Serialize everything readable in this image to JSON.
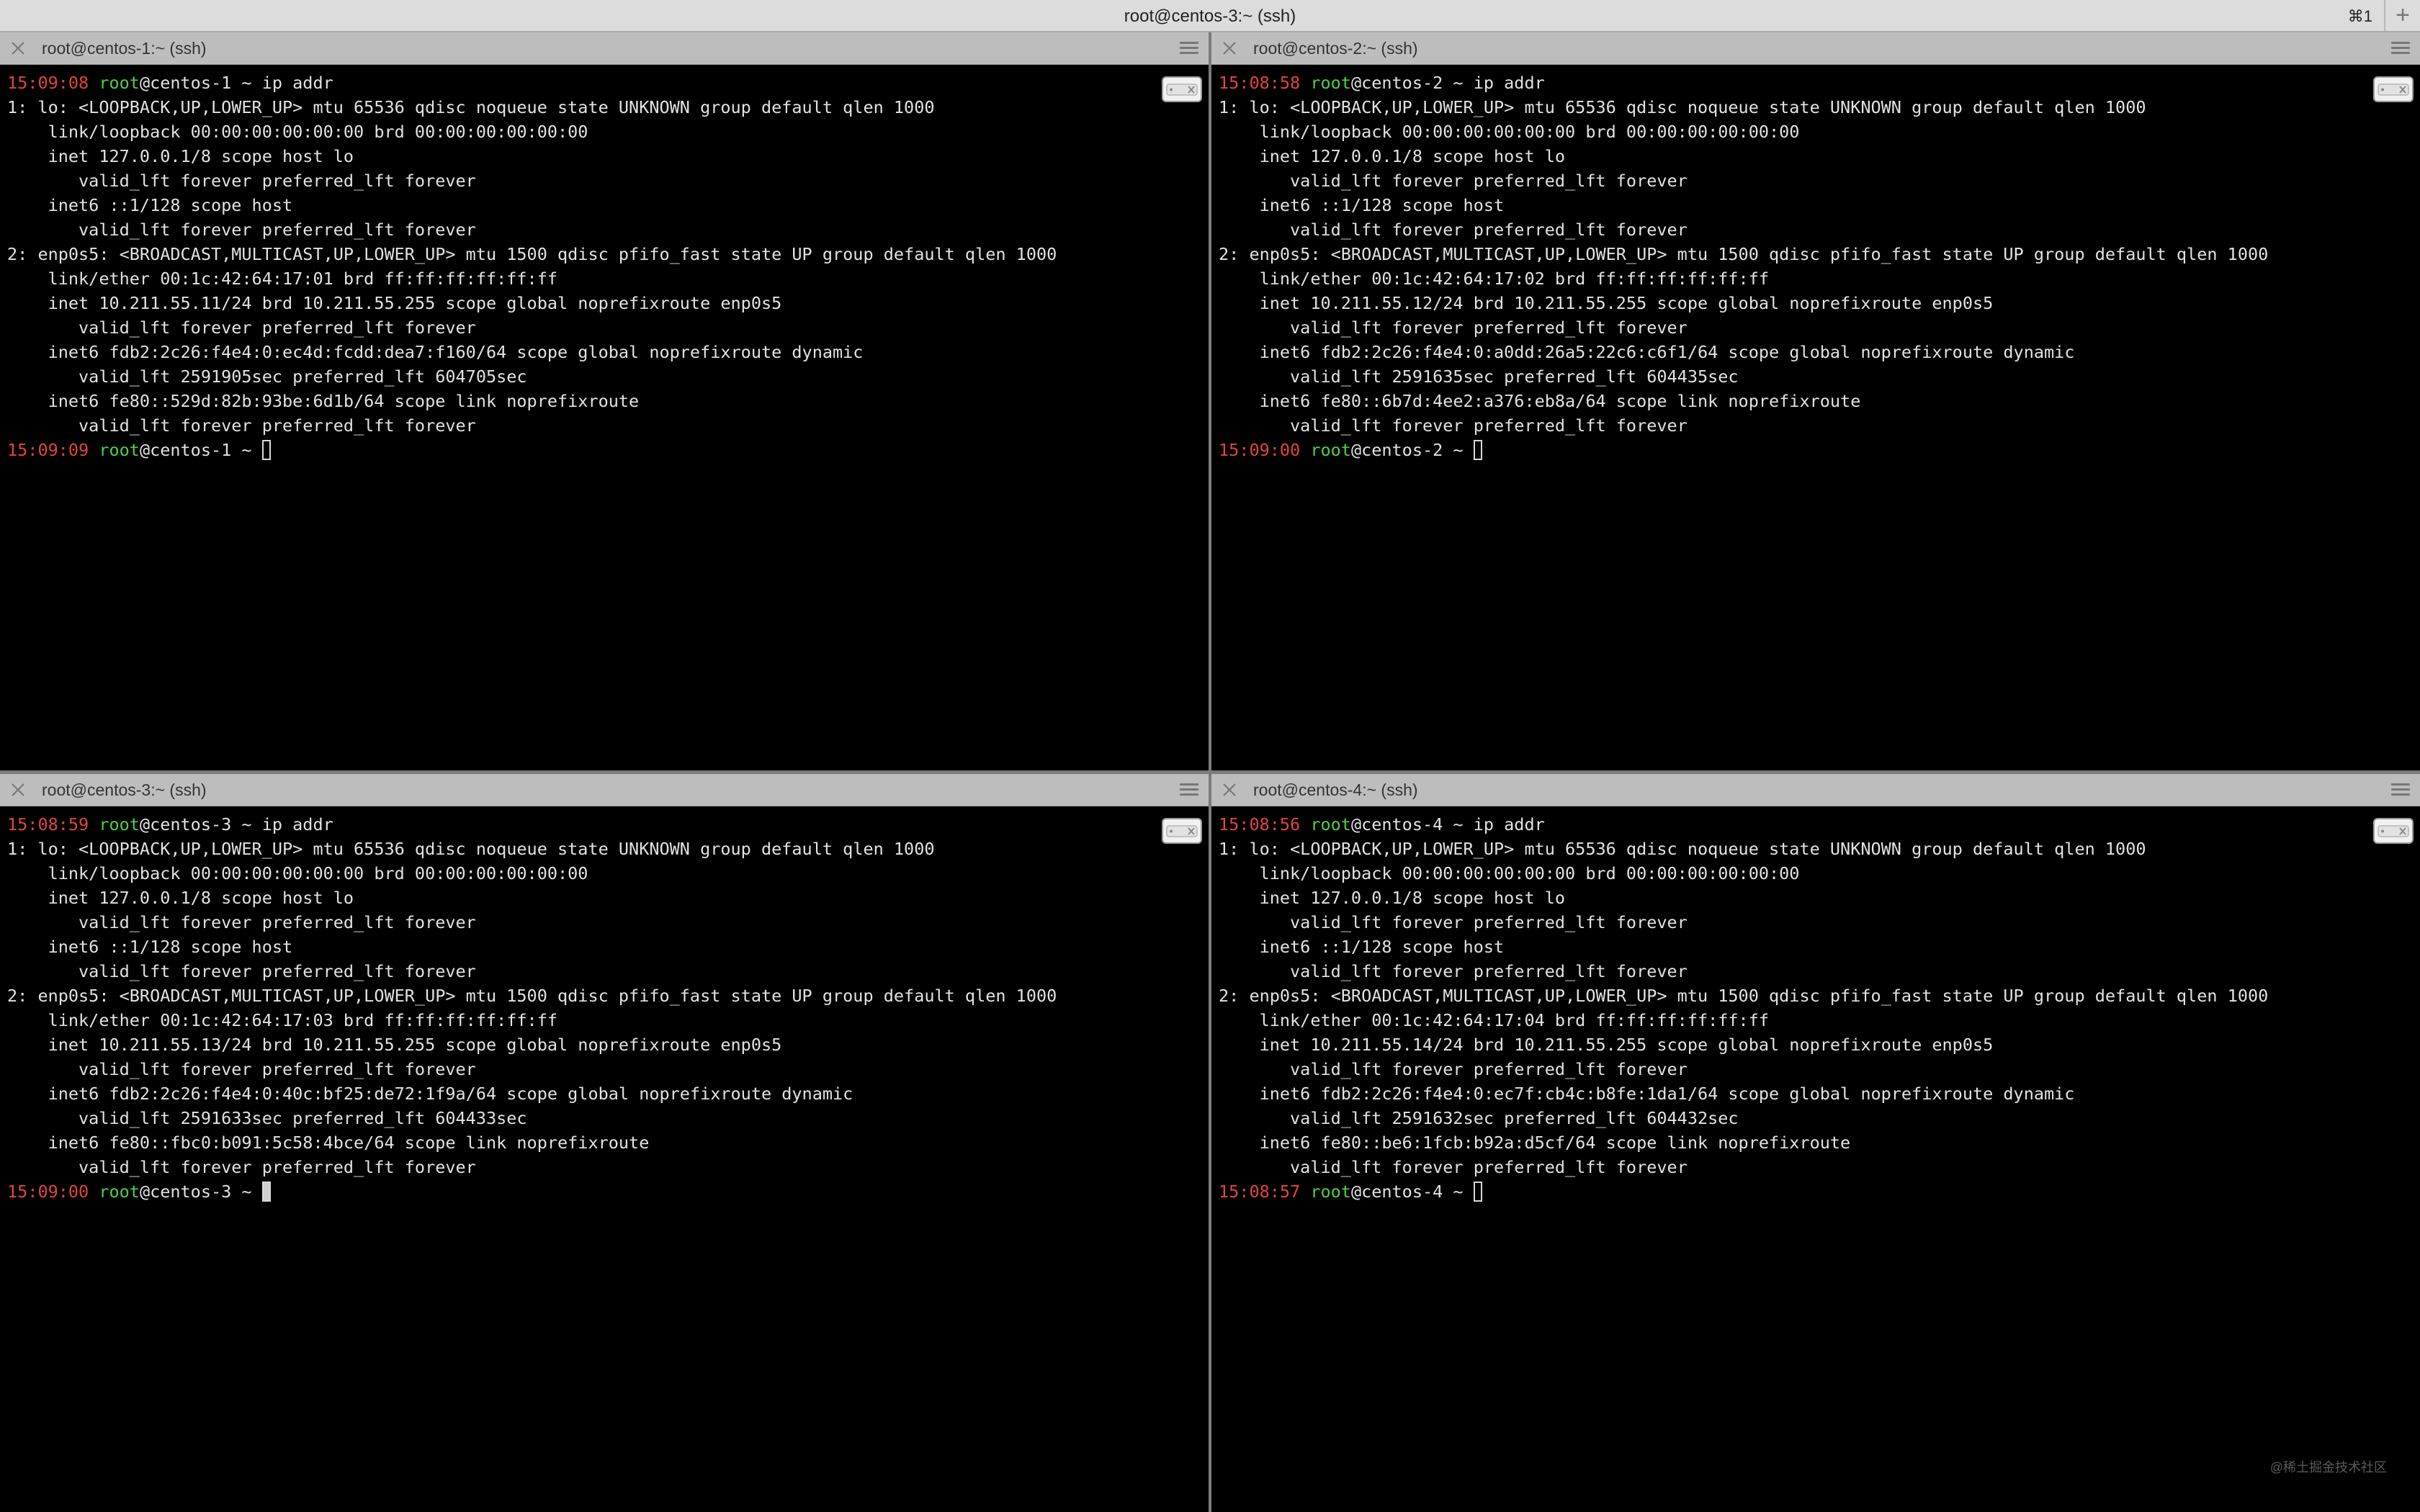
{
  "window": {
    "title": "root@centos-3:~ (ssh)",
    "shortcut": "⌘1",
    "new_tab": "+"
  },
  "colors": {
    "timestamp": "#e0463f",
    "user": "#4fcf4a",
    "text": "#e2e2e2",
    "background": "#000000"
  },
  "watermark": "@稀土掘金技术社区",
  "panes": [
    {
      "title": "root@centos-1:~ (ssh)",
      "cursor": "hollow",
      "prompt1": {
        "time": "15:09:08",
        "user": "root",
        "rest": "@centos-1 ~ ip addr"
      },
      "output": [
        "1: lo: <LOOPBACK,UP,LOWER_UP> mtu 65536 qdisc noqueue state UNKNOWN group default qlen 1000",
        "    link/loopback 00:00:00:00:00:00 brd 00:00:00:00:00:00",
        "    inet 127.0.0.1/8 scope host lo",
        "       valid_lft forever preferred_lft forever",
        "    inet6 ::1/128 scope host",
        "       valid_lft forever preferred_lft forever",
        "2: enp0s5: <BROADCAST,MULTICAST,UP,LOWER_UP> mtu 1500 qdisc pfifo_fast state UP group default qlen 1000",
        "    link/ether 00:1c:42:64:17:01 brd ff:ff:ff:ff:ff:ff",
        "    inet 10.211.55.11/24 brd 10.211.55.255 scope global noprefixroute enp0s5",
        "       valid_lft forever preferred_lft forever",
        "    inet6 fdb2:2c26:f4e4:0:ec4d:fcdd:dea7:f160/64 scope global noprefixroute dynamic",
        "       valid_lft 2591905sec preferred_lft 604705sec",
        "    inet6 fe80::529d:82b:93be:6d1b/64 scope link noprefixroute",
        "       valid_lft forever preferred_lft forever"
      ],
      "prompt2": {
        "time": "15:09:09",
        "user": "root",
        "rest": "@centos-1 ~ "
      }
    },
    {
      "title": "root@centos-2:~ (ssh)",
      "cursor": "hollow",
      "prompt1": {
        "time": "15:08:58",
        "user": "root",
        "rest": "@centos-2 ~ ip addr"
      },
      "output": [
        "1: lo: <LOOPBACK,UP,LOWER_UP> mtu 65536 qdisc noqueue state UNKNOWN group default qlen 1000",
        "    link/loopback 00:00:00:00:00:00 brd 00:00:00:00:00:00",
        "    inet 127.0.0.1/8 scope host lo",
        "       valid_lft forever preferred_lft forever",
        "    inet6 ::1/128 scope host",
        "       valid_lft forever preferred_lft forever",
        "2: enp0s5: <BROADCAST,MULTICAST,UP,LOWER_UP> mtu 1500 qdisc pfifo_fast state UP group default qlen 1000",
        "    link/ether 00:1c:42:64:17:02 brd ff:ff:ff:ff:ff:ff",
        "    inet 10.211.55.12/24 brd 10.211.55.255 scope global noprefixroute enp0s5",
        "       valid_lft forever preferred_lft forever",
        "    inet6 fdb2:2c26:f4e4:0:a0dd:26a5:22c6:c6f1/64 scope global noprefixroute dynamic",
        "       valid_lft 2591635sec preferred_lft 604435sec",
        "    inet6 fe80::6b7d:4ee2:a376:eb8a/64 scope link noprefixroute",
        "       valid_lft forever preferred_lft forever"
      ],
      "prompt2": {
        "time": "15:09:00",
        "user": "root",
        "rest": "@centos-2 ~ "
      }
    },
    {
      "title": "root@centos-3:~ (ssh)",
      "cursor": "solid",
      "prompt1": {
        "time": "15:08:59",
        "user": "root",
        "rest": "@centos-3 ~ ip addr"
      },
      "output": [
        "1: lo: <LOOPBACK,UP,LOWER_UP> mtu 65536 qdisc noqueue state UNKNOWN group default qlen 1000",
        "    link/loopback 00:00:00:00:00:00 brd 00:00:00:00:00:00",
        "    inet 127.0.0.1/8 scope host lo",
        "       valid_lft forever preferred_lft forever",
        "    inet6 ::1/128 scope host",
        "       valid_lft forever preferred_lft forever",
        "2: enp0s5: <BROADCAST,MULTICAST,UP,LOWER_UP> mtu 1500 qdisc pfifo_fast state UP group default qlen 1000",
        "    link/ether 00:1c:42:64:17:03 brd ff:ff:ff:ff:ff:ff",
        "    inet 10.211.55.13/24 brd 10.211.55.255 scope global noprefixroute enp0s5",
        "       valid_lft forever preferred_lft forever",
        "    inet6 fdb2:2c26:f4e4:0:40c:bf25:de72:1f9a/64 scope global noprefixroute dynamic",
        "       valid_lft 2591633sec preferred_lft 604433sec",
        "    inet6 fe80::fbc0:b091:5c58:4bce/64 scope link noprefixroute",
        "       valid_lft forever preferred_lft forever"
      ],
      "prompt2": {
        "time": "15:09:00",
        "user": "root",
        "rest": "@centos-3 ~ "
      }
    },
    {
      "title": "root@centos-4:~ (ssh)",
      "cursor": "hollow",
      "prompt1": {
        "time": "15:08:56",
        "user": "root",
        "rest": "@centos-4 ~ ip addr"
      },
      "output": [
        "1: lo: <LOOPBACK,UP,LOWER_UP> mtu 65536 qdisc noqueue state UNKNOWN group default qlen 1000",
        "    link/loopback 00:00:00:00:00:00 brd 00:00:00:00:00:00",
        "    inet 127.0.0.1/8 scope host lo",
        "       valid_lft forever preferred_lft forever",
        "    inet6 ::1/128 scope host",
        "       valid_lft forever preferred_lft forever",
        "2: enp0s5: <BROADCAST,MULTICAST,UP,LOWER_UP> mtu 1500 qdisc pfifo_fast state UP group default qlen 1000",
        "    link/ether 00:1c:42:64:17:04 brd ff:ff:ff:ff:ff:ff",
        "    inet 10.211.55.14/24 brd 10.211.55.255 scope global noprefixroute enp0s5",
        "       valid_lft forever preferred_lft forever",
        "    inet6 fdb2:2c26:f4e4:0:ec7f:cb4c:b8fe:1da1/64 scope global noprefixroute dynamic",
        "       valid_lft 2591632sec preferred_lft 604432sec",
        "    inet6 fe80::be6:1fcb:b92a:d5cf/64 scope link noprefixroute",
        "       valid_lft forever preferred_lft forever"
      ],
      "prompt2": {
        "time": "15:08:57",
        "user": "root",
        "rest": "@centos-4 ~ "
      }
    }
  ]
}
